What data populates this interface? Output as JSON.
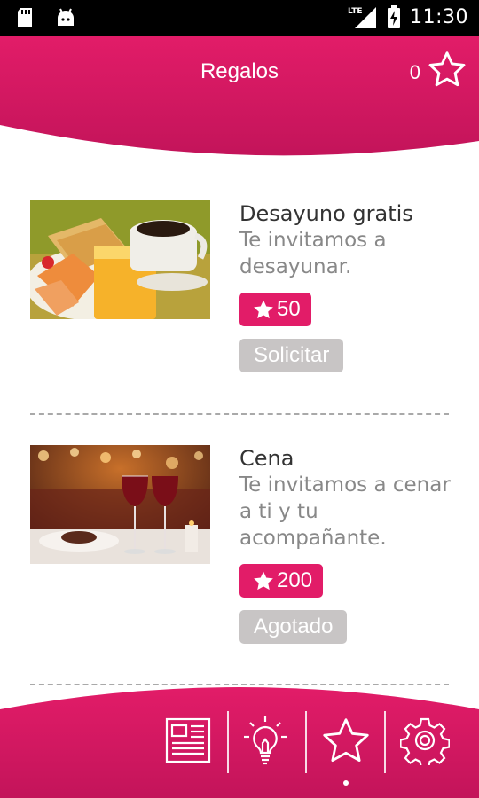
{
  "status_bar": {
    "time": "11:30",
    "network_label": "LTE",
    "icons": [
      "sd-card-icon",
      "android-icon",
      "signal-icon",
      "battery-charging-icon"
    ]
  },
  "header": {
    "title": "Regalos",
    "points": "0",
    "points_icon": "star-outline-icon"
  },
  "gifts": [
    {
      "title": "Desayuno gratis",
      "description": "Te invitamos a desayunar.",
      "cost": "50",
      "action": "Solicitar",
      "image": "breakfast-photo"
    },
    {
      "title": "Cena",
      "description": "Te invitamos a cenar a ti y tu acompañante.",
      "cost": "200",
      "action": "Agotado",
      "image": "dinner-photo"
    }
  ],
  "bottom_nav": {
    "items": [
      {
        "icon": "news-icon"
      },
      {
        "icon": "lightbulb-icon"
      },
      {
        "icon": "star-icon",
        "active": true
      },
      {
        "icon": "settings-gear-icon"
      }
    ]
  },
  "colors": {
    "brand": "#e21c68",
    "brand_dark": "#c3145a",
    "button_disabled": "#c8c5c5"
  }
}
